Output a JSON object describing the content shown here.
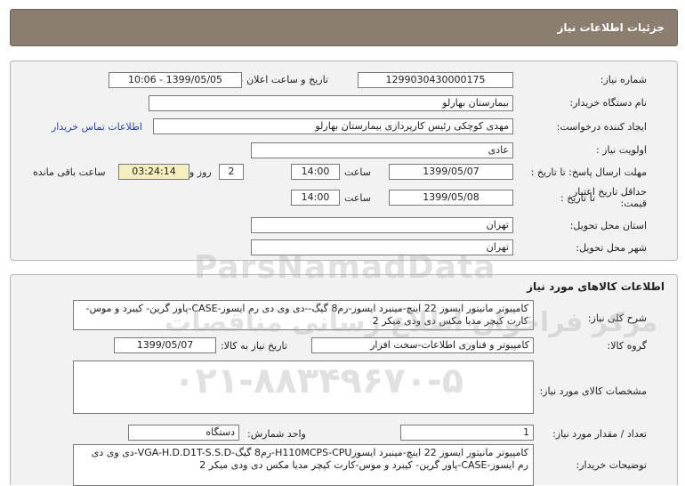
{
  "page": {
    "title": "جزئیات اطلاعات نیاز"
  },
  "details": {
    "need_number_label": "شماره نیاز:",
    "need_number": "1299030430000175",
    "announce_label": "تاریخ و ساعت اعلان عمومی:",
    "announce_value": "1399/05/05 - 10:06",
    "buyer_org_label": "نام دستگاه خریدار:",
    "buyer_org": "بیمارستان بهارلو",
    "requester_label": "ایجاد کننده درخواست:",
    "requester": "مهدی کوچکی  رئیس کارپردازی بیمارستان بهارلو",
    "contact_link": "اطلاعات تماس خریدار",
    "priority_label": "اولویت نیاز :",
    "priority": "عادی",
    "reply_deadline_label": "مهلت ارسال پاسخ: تا تاریخ :",
    "reply_date": "1399/05/07",
    "time_label": "ساعت",
    "reply_time": "14:00",
    "days_value": "2",
    "days_label": "روز و",
    "remaining_time": "03:24:14",
    "remaining_label": "ساعت باقی مانده",
    "validity_label_line1": "حداقل تاریخ اعتبار",
    "validity_label_line2": "قیمت:",
    "validity_to_label": "تا تاریخ :",
    "validity_date": "1399/05/08",
    "validity_time": "14:00",
    "province_label": "استان محل تحویل:",
    "province": "تهران",
    "city_label": "شهر محل تحویل:",
    "city": "تهران"
  },
  "goods": {
    "section_title": "اطلاعات کالاهای مورد نیاز",
    "summary_label": "شرح کلی نیاز:",
    "summary": "کامپیوتر مانیتور ایسوز 22 اینچ-مینبرد ایسوز-رم8 گیگ--دی وی دی رم ایسوز-CASE-پاور گرین- کیبرد و موس-کارت کپچر مدیا مکس دی ودی میکر 2",
    "group_label": "گروه کالا:",
    "group": "کامپیوتر و فناوری اطلاعات-سخت افزار",
    "need_date_label": "تاریخ نیاز به کالا:",
    "need_date": "1399/05/07",
    "specs_label": "مشخصات کالای مورد نیاز:",
    "specs": "",
    "quantity_label": "تعداد / مقدار مورد نیاز:",
    "quantity": "1",
    "unit_label": "واحد شمارش:",
    "unit": "دستگاه",
    "buyer_notes_label": "توضیحات خریدار:",
    "buyer_notes": "کامپیوتر مانیتور ایسوز 22 اینچ-مینبرد ایسوزH110MCPS-CPU-رم8 گیگ-VGA-H.D.D1T-S.S.D-دی وی دی رم ایسوز-CASE-پاور گرین- کیبرد و موس-کارت کپچر مدیا مکس دی ودی میکر 2"
  },
  "watermark": {
    "brand": "ParsNamadData",
    "persian": "مرکز فراخوان اطلاع رسانی مناقصات",
    "phone": "۰۲۱-۸۸۳۴۹۶۷۰-۵"
  }
}
